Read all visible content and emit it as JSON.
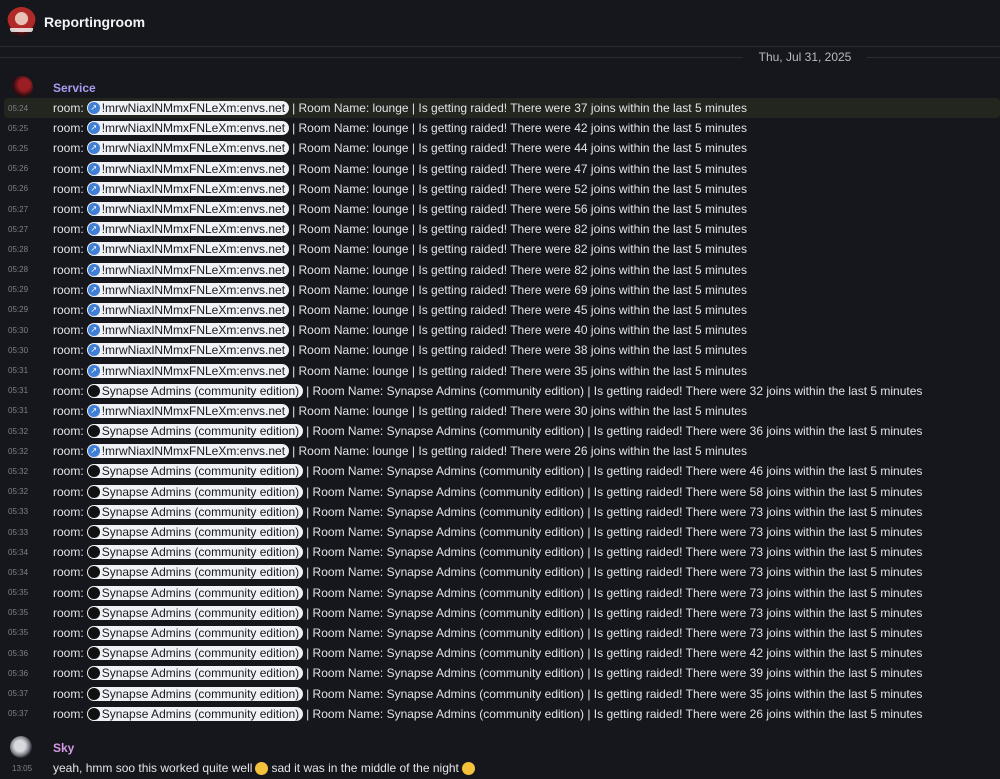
{
  "header": {
    "room_name": "Reportingroom"
  },
  "date_separator": "Thu, Jul 31, 2025",
  "groups": {
    "service": {
      "sender": "Service"
    },
    "sky": {
      "sender": "Sky"
    }
  },
  "labels": {
    "room_prefix": "room:"
  },
  "messages": [
    {
      "time": "05:24",
      "room": "!mrwNiaxlNMmxFNLeXm:envs.net",
      "type": "link",
      "name": "lounge",
      "count": "37"
    },
    {
      "time": "05:25",
      "room": "!mrwNiaxlNMmxFNLeXm:envs.net",
      "type": "link",
      "name": "lounge",
      "count": "42"
    },
    {
      "time": "05:25",
      "room": "!mrwNiaxlNMmxFNLeXm:envs.net",
      "type": "link",
      "name": "lounge",
      "count": "44"
    },
    {
      "time": "05:26",
      "room": "!mrwNiaxlNMmxFNLeXm:envs.net",
      "type": "link",
      "name": "lounge",
      "count": "47"
    },
    {
      "time": "05:26",
      "room": "!mrwNiaxlNMmxFNLeXm:envs.net",
      "type": "link",
      "name": "lounge",
      "count": "52"
    },
    {
      "time": "05:27",
      "room": "!mrwNiaxlNMmxFNLeXm:envs.net",
      "type": "link",
      "name": "lounge",
      "count": "56"
    },
    {
      "time": "05:27",
      "room": "!mrwNiaxlNMmxFNLeXm:envs.net",
      "type": "link",
      "name": "lounge",
      "count": "82"
    },
    {
      "time": "05:28",
      "room": "!mrwNiaxlNMmxFNLeXm:envs.net",
      "type": "link",
      "name": "lounge",
      "count": "82"
    },
    {
      "time": "05:28",
      "room": "!mrwNiaxlNMmxFNLeXm:envs.net",
      "type": "link",
      "name": "lounge",
      "count": "82"
    },
    {
      "time": "05:29",
      "room": "!mrwNiaxlNMmxFNLeXm:envs.net",
      "type": "link",
      "name": "lounge",
      "count": "69"
    },
    {
      "time": "05:29",
      "room": "!mrwNiaxlNMmxFNLeXm:envs.net",
      "type": "link",
      "name": "lounge",
      "count": "45"
    },
    {
      "time": "05:30",
      "room": "!mrwNiaxlNMmxFNLeXm:envs.net",
      "type": "link",
      "name": "lounge",
      "count": "40"
    },
    {
      "time": "05:30",
      "room": "!mrwNiaxlNMmxFNLeXm:envs.net",
      "type": "link",
      "name": "lounge",
      "count": "38"
    },
    {
      "time": "05:31",
      "room": "!mrwNiaxlNMmxFNLeXm:envs.net",
      "type": "link",
      "name": "lounge",
      "count": "35"
    },
    {
      "time": "05:31",
      "room": "Synapse Admins (community edition)",
      "type": "room",
      "name": "Synapse Admins (community edition)",
      "count": "32"
    },
    {
      "time": "05:31",
      "room": "!mrwNiaxlNMmxFNLeXm:envs.net",
      "type": "link",
      "name": "lounge",
      "count": "30"
    },
    {
      "time": "05:32",
      "room": "Synapse Admins (community edition)",
      "type": "room",
      "name": "Synapse Admins (community edition)",
      "count": "36"
    },
    {
      "time": "05:32",
      "room": "!mrwNiaxlNMmxFNLeXm:envs.net",
      "type": "link",
      "name": "lounge",
      "count": "26"
    },
    {
      "time": "05:32",
      "room": "Synapse Admins (community edition)",
      "type": "room",
      "name": "Synapse Admins (community edition)",
      "count": "46"
    },
    {
      "time": "05:32",
      "room": "Synapse Admins (community edition)",
      "type": "room",
      "name": "Synapse Admins (community edition)",
      "count": "58"
    },
    {
      "time": "05:33",
      "room": "Synapse Admins (community edition)",
      "type": "room",
      "name": "Synapse Admins (community edition)",
      "count": "73"
    },
    {
      "time": "05:33",
      "room": "Synapse Admins (community edition)",
      "type": "room",
      "name": "Synapse Admins (community edition)",
      "count": "73"
    },
    {
      "time": "05:34",
      "room": "Synapse Admins (community edition)",
      "type": "room",
      "name": "Synapse Admins (community edition)",
      "count": "73"
    },
    {
      "time": "05:34",
      "room": "Synapse Admins (community edition)",
      "type": "room",
      "name": "Synapse Admins (community edition)",
      "count": "73"
    },
    {
      "time": "05:35",
      "room": "Synapse Admins (community edition)",
      "type": "room",
      "name": "Synapse Admins (community edition)",
      "count": "73"
    },
    {
      "time": "05:35",
      "room": "Synapse Admins (community edition)",
      "type": "room",
      "name": "Synapse Admins (community edition)",
      "count": "73"
    },
    {
      "time": "05:35",
      "room": "Synapse Admins (community edition)",
      "type": "room",
      "name": "Synapse Admins (community edition)",
      "count": "73"
    },
    {
      "time": "05:36",
      "room": "Synapse Admins (community edition)",
      "type": "room",
      "name": "Synapse Admins (community edition)",
      "count": "42"
    },
    {
      "time": "05:36",
      "room": "Synapse Admins (community edition)",
      "type": "room",
      "name": "Synapse Admins (community edition)",
      "count": "39"
    },
    {
      "time": "05:37",
      "room": "Synapse Admins (community edition)",
      "type": "room",
      "name": "Synapse Admins (community edition)",
      "count": "35"
    },
    {
      "time": "05:37",
      "room": "Synapse Admins (community edition)",
      "type": "room",
      "name": "Synapse Admins (community edition)",
      "count": "26"
    }
  ],
  "last_message": {
    "time": "13:05",
    "text_before": "yeah, hmm soo this worked quite well",
    "emoji_1": "grinning-sweat-emoji",
    "text_after": "sad it was in the middle of the night",
    "emoji_2": "hand-over-mouth-emoji"
  },
  "colors": {
    "background": "#16171c",
    "service_name": "#a89cf2",
    "sky_name": "#d59ae6",
    "highlight_row": "#23251f",
    "link_pill_icon": "#3f7fd6"
  },
  "icons": {
    "link_pill": "link-icon",
    "room_pill": "room-avatar-icon"
  }
}
